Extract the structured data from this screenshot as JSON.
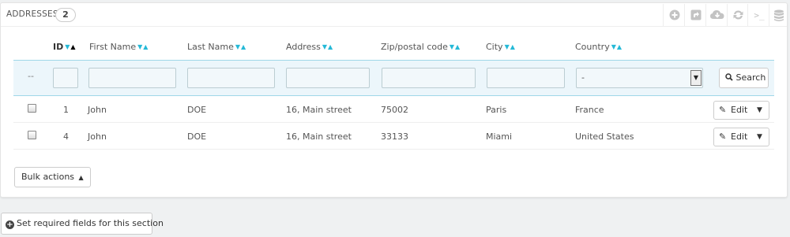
{
  "panel": {
    "title": "ADDRESSES",
    "count": "2"
  },
  "toolbar": {
    "icons": [
      "add-new-icon",
      "export-icon",
      "import-icon",
      "refresh-icon",
      "sql-query-icon",
      "sql-manager-icon"
    ]
  },
  "columns": {
    "id": "ID",
    "first_name": "First Name",
    "last_name": "Last Name",
    "address": "Address",
    "zip": "Zip/postal code",
    "city": "City",
    "country": "Country"
  },
  "filters": {
    "dash": "--",
    "country_selected": "-",
    "search_label": "Search"
  },
  "rows": [
    {
      "id": "1",
      "first_name": "John",
      "last_name": "DOE",
      "address": "16, Main street",
      "zip": "75002",
      "city": "Paris",
      "country": "France",
      "action": "Edit"
    },
    {
      "id": "4",
      "first_name": "John",
      "last_name": "DOE",
      "address": "16, Main street",
      "zip": "33133",
      "city": "Miami",
      "country": "United States",
      "action": "Edit"
    }
  ],
  "bulk_actions": {
    "label": "Bulk actions"
  },
  "footer": {
    "required_fields_label": "Set required fields for this section"
  },
  "colors": {
    "accent": "#25b9d7",
    "filter_bg": "#ecf6fb",
    "page_bg": "#eff1f2"
  }
}
